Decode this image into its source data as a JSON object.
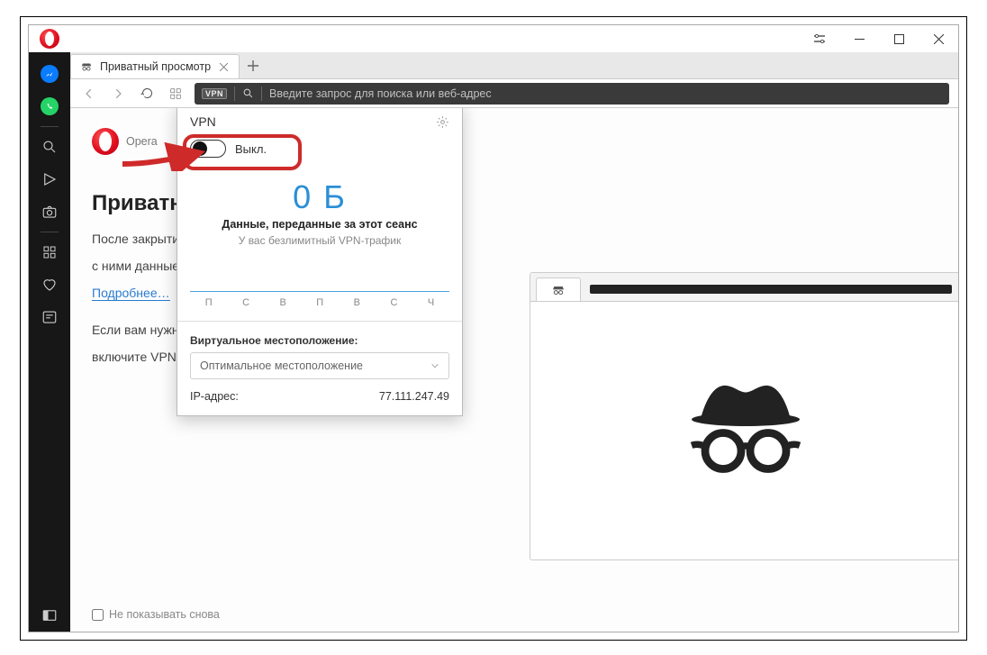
{
  "tab": {
    "title": "Приватный просмотр"
  },
  "addrbar": {
    "vpn_badge": "VPN",
    "placeholder": "Введите запрос для поиска или веб-адрес"
  },
  "page": {
    "logo_label": "Opera",
    "heading": "Приватн",
    "line1": "После закрыти",
    "line2": "с ними данные",
    "learn_more": "Подробнее…",
    "line3": "Если вам нужно",
    "line4": "включите VPN.",
    "dont_show": "Не показывать снова"
  },
  "vpn": {
    "title": "VPN",
    "toggle_label": "Выкл.",
    "data_amount": "0 Б",
    "data_caption": "Данные, переданные за этот сеанс",
    "unlimited": "У вас безлимитный VPN-трафик",
    "days": [
      "П",
      "С",
      "В",
      "П",
      "В",
      "С",
      "Ч"
    ],
    "location_label": "Виртуальное местоположение:",
    "location_value": "Оптимальное местоположение",
    "ip_label": "IP-адрес:",
    "ip_value": "77.111.247.49"
  }
}
